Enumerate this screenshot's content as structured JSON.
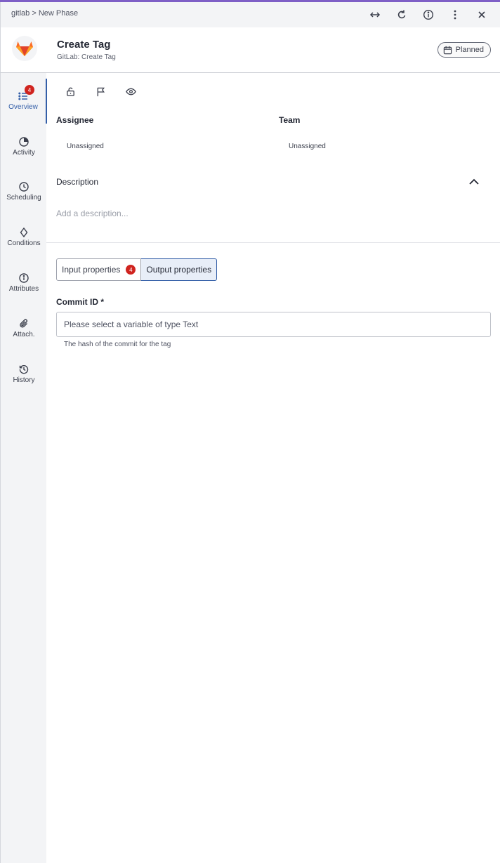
{
  "breadcrumb": "gitlab > New Phase",
  "header": {
    "title": "Create Tag",
    "subtitle": "GitLab: Create Tag",
    "status": "Planned"
  },
  "sidebar": {
    "items": [
      {
        "label": "Overview",
        "badge": "4"
      },
      {
        "label": "Activity"
      },
      {
        "label": "Scheduling"
      },
      {
        "label": "Conditions"
      },
      {
        "label": "Attributes"
      },
      {
        "label": "Attach."
      },
      {
        "label": "History"
      }
    ]
  },
  "fields": {
    "assignee_label": "Assignee",
    "assignee_value": "Unassigned",
    "team_label": "Team",
    "team_value": "Unassigned"
  },
  "description": {
    "title": "Description",
    "placeholder": "Add a description..."
  },
  "tabs": [
    {
      "label": "Input properties",
      "badge": "4"
    },
    {
      "label": "Output properties"
    }
  ],
  "commit": {
    "label": "Commit ID *",
    "placeholder": "Please select a variable of type Text",
    "helper": "The hash of the commit for the tag"
  },
  "colors": {
    "accent": "#7e5fc6",
    "active_nav": "#345fa8",
    "badge": "#d0241f",
    "gitlab_orange": "#e24329"
  }
}
